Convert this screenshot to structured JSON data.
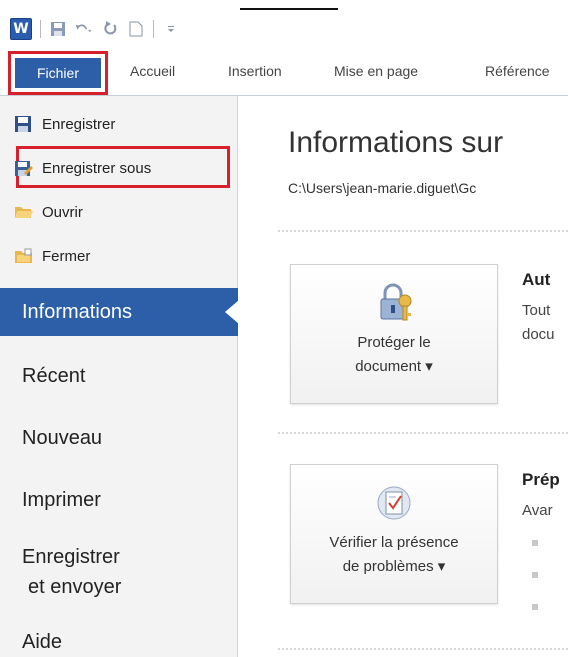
{
  "qat": {
    "app_logo": "W",
    "icons": [
      "save-icon",
      "undo-icon",
      "redo-icon",
      "new-document-icon",
      "customize-icon"
    ]
  },
  "tabs": {
    "file": "Fichier",
    "items": [
      "Accueil",
      "Insertion",
      "Mise en page",
      "Référence"
    ]
  },
  "sidebar": {
    "commands": [
      {
        "label": "Enregistrer",
        "icon": "save-icon"
      },
      {
        "label": "Enregistrer sous",
        "icon": "save-as-icon"
      },
      {
        "label": "Ouvrir",
        "icon": "open-folder-icon"
      },
      {
        "label": "Fermer",
        "icon": "close-folder-icon"
      }
    ],
    "nav": {
      "informations": "Informations",
      "recent": "Récent",
      "nouveau": "Nouveau",
      "imprimer": "Imprimer",
      "enregistrer_line1": "Enregistrer",
      "enregistrer_line2": "et envoyer",
      "aide": "Aide"
    }
  },
  "main": {
    "title": "Informations sur",
    "path": "C:\\Users\\jean-marie.diguet\\Gc",
    "protect": {
      "line1": "Protéger le",
      "line2": "document ▾",
      "side_title": "Aut",
      "side_line1": "Tout",
      "side_line2": "docu"
    },
    "check": {
      "line1": "Vérifier la présence",
      "line2": "de problèmes ▾",
      "side_title": "Prép",
      "side_line1": "Avar"
    }
  },
  "colors": {
    "accent_blue": "#2c5fa8",
    "highlight_red": "#d8202c"
  }
}
